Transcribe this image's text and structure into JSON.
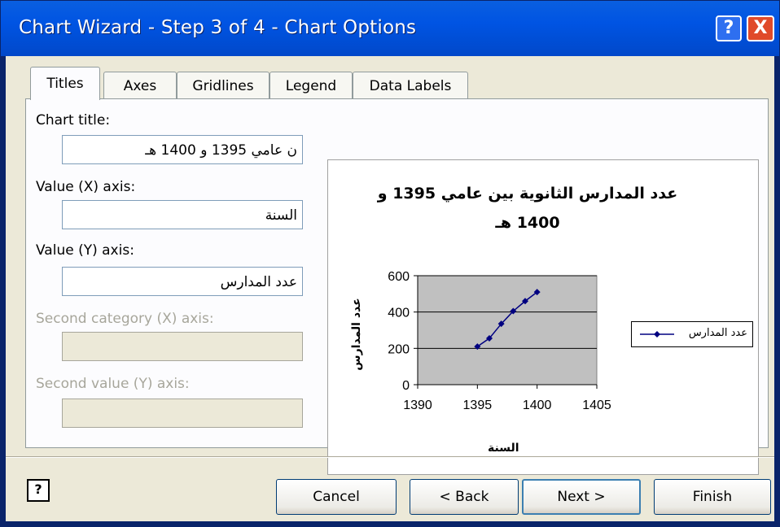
{
  "window": {
    "title": "Chart Wizard - Step 3 of 4 - Chart Options",
    "help_button": "?",
    "close_button": "X"
  },
  "tabs": [
    {
      "label": "Titles",
      "active": true
    },
    {
      "label": "Axes",
      "active": false
    },
    {
      "label": "Gridlines",
      "active": false
    },
    {
      "label": "Legend",
      "active": false
    },
    {
      "label": "Data Labels",
      "active": false
    }
  ],
  "titles": {
    "chart_title_label": "Chart title:",
    "chart_title_value": "ن عامي 1395 و 1400 هـ",
    "value_x_label": "Value (X) axis:",
    "value_x_value": "السنة",
    "value_y_label": "Value (Y) axis:",
    "value_y_value": "عدد المدارس",
    "second_category_label": "Second category (X) axis:",
    "second_value_label": "Second value (Y) axis:"
  },
  "preview": {
    "title_line1": "عدد المدارس الثانوية بين عامي 1395 و",
    "title_line2": "1400 هـ",
    "xlabel": "السنة",
    "ylabel": "عدد المدارس",
    "legend_label": "عدد المدارس"
  },
  "chart_data": {
    "type": "scatter",
    "title": "عدد المدارس الثانوية بين عامي 1395 و 1400 هـ",
    "xlabel": "السنة",
    "ylabel": "عدد المدارس",
    "xlim": [
      1390,
      1405
    ],
    "ylim": [
      0,
      600
    ],
    "x_ticks": [
      1390,
      1395,
      1400,
      1405
    ],
    "y_ticks": [
      0,
      200,
      400,
      600
    ],
    "grid": "horizontal",
    "legend": "right",
    "series": [
      {
        "name": "عدد المدارس",
        "color": "#000080",
        "x": [
          1395,
          1396,
          1397,
          1398,
          1399,
          1400
        ],
        "y": [
          210,
          255,
          335,
          405,
          460,
          510
        ]
      }
    ]
  },
  "buttons": {
    "help_icon": "?",
    "cancel": "Cancel",
    "back": "< Back",
    "next": "Next >",
    "finish": "Finish"
  },
  "colors": {
    "titlebar": "#0054e3",
    "dialog_bg": "#ece9d8",
    "plot_bg": "#c0c0c0",
    "series": "#000080"
  }
}
